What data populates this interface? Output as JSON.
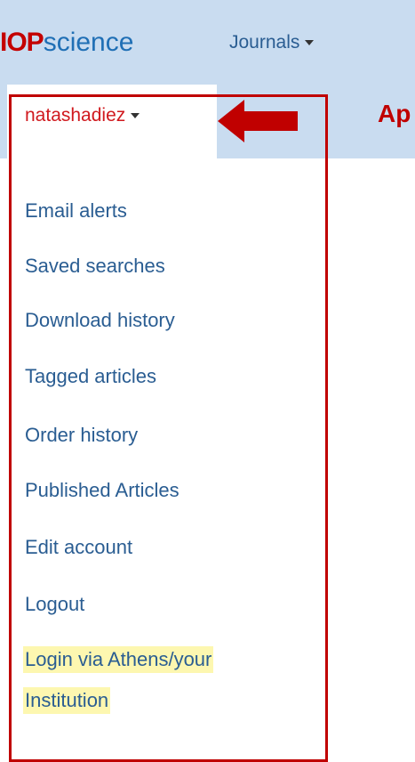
{
  "header": {
    "logo_iop": "IOP",
    "logo_science": "science",
    "journals_label": "Journals"
  },
  "user": {
    "name": "natashadiez"
  },
  "annotation": {
    "text": "Ap",
    "color": "#c00000"
  },
  "menu": {
    "items": [
      {
        "label": "Email alerts"
      },
      {
        "label": "Saved searches"
      },
      {
        "label": "Download history"
      },
      {
        "label": "Tagged articles"
      },
      {
        "label": "Order history"
      },
      {
        "label": "Published Articles"
      },
      {
        "label": "Edit account"
      },
      {
        "label": "Logout"
      }
    ],
    "athens_line1": "Login via Athens/your",
    "athens_line2": "Institution"
  },
  "colors": {
    "header_bg": "#c9dcf0",
    "link": "#2a5d92",
    "username": "#d0191e",
    "highlight": "#fdf7b0"
  }
}
